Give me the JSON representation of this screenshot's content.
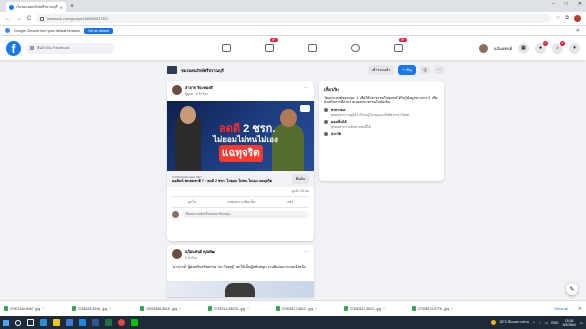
{
  "browser": {
    "tab_title": "เว็บชมรมคนรักษ์ศรีปราณบุรี | Face",
    "new_tab": "+",
    "win_controls": [
      "–",
      "□",
      "✕"
    ],
    "url": "facebook.com/groups/1680920117307",
    "nav": {
      "back": "←",
      "forward": "→",
      "reload": "C"
    }
  },
  "infobar": {
    "message": "Google Chrome isn't your default browser",
    "button": "Set as default",
    "close": "✕"
  },
  "fb": {
    "search_placeholder": "ค้นหาบน Facebook",
    "nav_badges": {
      "watch": "9+",
      "groups": "9+"
    },
    "profile_name": "แก้มแทนย์",
    "notif_badges": {
      "messenger": "1",
      "notifications": "9"
    }
  },
  "group": {
    "name": "ชมรมคนรักษ์ศรีปราณบุรี",
    "joined": "เข้าร่วมแล้ว",
    "invite": "+ เชิญ",
    "search": "Q",
    "more": "···"
  },
  "post1": {
    "author": "สาลาจ ริยะทองดี",
    "meta": "ผู้ดูแล · 5 ชั่วโมง",
    "img_line1a": "ลดดี",
    "img_line1b": " 2 ชรก.",
    "img_line2": "ไม่ยอมไม่ทนไม่เอง",
    "img_line3": "แฉทุจริต",
    "link_domain": "KOMCHADLUEK.NET",
    "link_title": "คอลัมน์ ชนชลชาติ 7 : ลดดี 2 ชรก. ไม่ยอม ไม่ทน ไม่เอง แฉทุจริต",
    "share_label": "ยืนยัน",
    "stats": "ดูแล้ว 13 คน",
    "actions": [
      "ถูกใจ",
      "แสดงความคิดเห็น",
      "แชร์"
    ],
    "comment_placeholder": "เขียนความคิดเห็นต่อสมาชิกกลุ่ม..."
  },
  "post2": {
    "author": "แก้มแทนย์ คุณพัฒ",
    "meta": "5 ชั่วโมง",
    "text": "\"อาจารย์\" ผู้ส่งเสริมจริยธรรม \"ดร.วิเชษฐ์\" ยกให้เป็นผู้สนับสนุน งานดีเด่นมากรอบจังหวัด"
  },
  "about": {
    "title": "เกี่ยวกับ",
    "desc": "วัตถุประสงค์ของกลุ่ม: 1. เพื่อให้ประชาชนในชุมชนได้รับรู้ข้อมูลข่าวสาร 2. เพื่อส่งเสริมการมีส่วนร่วมของประชาชนในท้องถิ่น",
    "public_label": "สาธารณะ",
    "public_sub": "ทุกคนสามารถดูได้ว่าใครอยู่ในกลุ่มและสิ่งที่พวกเขาโพสต์",
    "visible_label": "มองเห็นได้",
    "visible_sub": "ทุกคนสามารถค้นหากลุ่มนี้ได้",
    "history_label": "ประวัติ"
  },
  "downloads": [
    {
      "name": "2790744e-6967..jpg"
    },
    {
      "name": "2766328-3048...jpg"
    },
    {
      "name": "23919366-9815...jpg"
    },
    {
      "name": "2751914-28675...jpg"
    },
    {
      "name": "27003517-6812...jpg"
    },
    {
      "name": "27630447-3823...jpg"
    },
    {
      "name": "27028972-9776...jpg"
    }
  ],
  "downloads_show_all": "Show all",
  "taskbar": {
    "weather": "28°C มีแดดบางส่วน",
    "lang": "ENG",
    "time": "15:26",
    "date": "5/3/2564"
  },
  "colors": {
    "fb_blue": "#1877f2",
    "badge_red": "#e41e3f",
    "taskbar": "#1e2a3a"
  }
}
